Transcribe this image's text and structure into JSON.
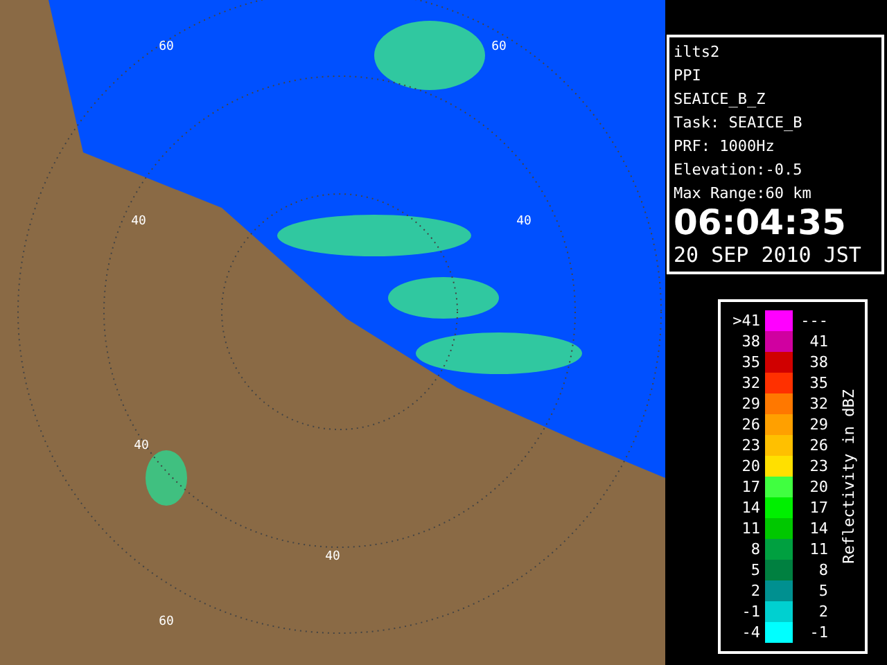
{
  "map": {
    "ring_labels": [
      "60",
      "60",
      "40",
      "40",
      "40",
      "40",
      "60"
    ]
  },
  "info": {
    "lines": [
      "ilts2",
      "PPI",
      "SEAICE_B_Z",
      "Task: SEAICE_B",
      "PRF: 1000Hz",
      "Elevation:-0.5",
      "Max Range:60 km"
    ],
    "time": "06:04:35",
    "date": "20 SEP 2010 JST"
  },
  "legend": {
    "title": "Reflectivity in dBZ",
    "rows": [
      {
        "low": ">41",
        "high": "---",
        "color": "#ff00ff"
      },
      {
        "low": "38",
        "high": "41",
        "color": "#d000a0"
      },
      {
        "low": "35",
        "high": "38",
        "color": "#d00000"
      },
      {
        "low": "32",
        "high": "35",
        "color": "#ff3000"
      },
      {
        "low": "29",
        "high": "32",
        "color": "#ff7800"
      },
      {
        "low": "26",
        "high": "29",
        "color": "#ffa000"
      },
      {
        "low": "23",
        "high": "26",
        "color": "#ffc000"
      },
      {
        "low": "20",
        "high": "23",
        "color": "#ffe000"
      },
      {
        "low": "17",
        "high": "20",
        "color": "#40ff40"
      },
      {
        "low": "14",
        "high": "17",
        "color": "#00f000"
      },
      {
        "low": "11",
        "high": "14",
        "color": "#00c800"
      },
      {
        "low": "8",
        "high": "11",
        "color": "#00a040"
      },
      {
        "low": "5",
        "high": "8",
        "color": "#008040"
      },
      {
        "low": "2",
        "high": "5",
        "color": "#009090"
      },
      {
        "low": "-1",
        "high": "2",
        "color": "#00d0d0"
      },
      {
        "low": "-4",
        "high": "-1",
        "color": "#00ffff"
      }
    ]
  }
}
